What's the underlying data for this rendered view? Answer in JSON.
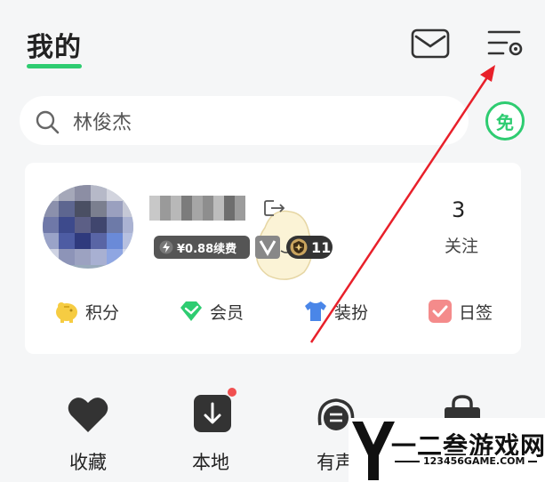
{
  "header": {
    "title": "我的",
    "mail_icon": "mail-icon",
    "settings_icon": "settings-icon"
  },
  "search": {
    "text": "林俊杰",
    "icon": "search-icon"
  },
  "free_badge": "免",
  "profile": {
    "vip_text": "¥0.88续费",
    "level": "11",
    "follow_count": "3",
    "follow_label": "关注"
  },
  "card_actions": [
    {
      "label": "积分",
      "icon": "piggy-bank-icon"
    },
    {
      "label": "会员",
      "icon": "diamond-icon"
    },
    {
      "label": "装扮",
      "icon": "tshirt-icon"
    },
    {
      "label": "日签",
      "icon": "checkbox-icon"
    }
  ],
  "shortcuts": [
    {
      "label": "收藏",
      "icon": "heart-icon"
    },
    {
      "label": "本地",
      "icon": "download-icon"
    },
    {
      "label": "有声",
      "icon": "headphones-icon"
    },
    {
      "label": "",
      "icon": "bag-icon"
    }
  ],
  "watermark": {
    "title": "一二叁游戏网",
    "url": "123456GAME.COM"
  },
  "colors": {
    "accent": "#2ecc71",
    "background": "#f5f6f7",
    "arrow": "#e8202a",
    "notification": "#f05050"
  }
}
